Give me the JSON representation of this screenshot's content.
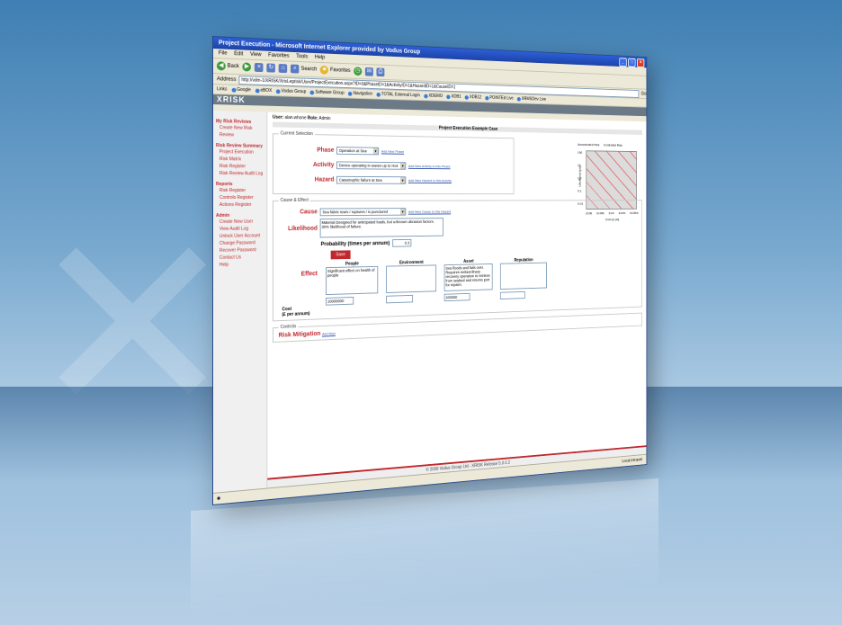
{
  "window": {
    "title": "Project Execution - Microsoft Internet Explorer provided by Vodus Group",
    "menus": [
      "File",
      "Edit",
      "View",
      "Favorites",
      "Tools",
      "Help"
    ],
    "toolbar": {
      "back": "Back",
      "search": "Search",
      "favorites": "Favorites"
    },
    "address_label": "Address",
    "address_value": "http://vdm-1/XRISK/XrisLegrisk/User/ProjectExecution.aspx?ID=3&PhaseID=1&ActivityID=1&HazardID=1&CauseID=1",
    "links_label": "Links",
    "links": [
      "Google",
      "eBOX",
      "Vodus Group",
      "Software Group",
      "Navigation",
      "TOTAL External Login",
      "XDEMO",
      "XDB1",
      "XDB12",
      "POINTEd Live",
      "XRMSDev Live"
    ],
    "go_label": "Go",
    "status_zone": "Local intranet"
  },
  "app": {
    "logo": "XRISK",
    "user_label": "User:",
    "user_name": "alan.whone",
    "role_label": "Role:",
    "role_name": "Admin",
    "page_title": "Project Execution Example Case"
  },
  "sidebar": {
    "sections": [
      {
        "heading": "My Risk Reviews",
        "items": [
          "Create New Risk Review"
        ]
      },
      {
        "heading": "Risk Review Summary",
        "items": [
          "Project Execution",
          "Risk Matrix",
          "Risk Register",
          "Risk Review Audit Log"
        ]
      },
      {
        "heading": "Reports",
        "items": [
          "Risk Register",
          "Controls Register",
          "Actions Register"
        ]
      },
      {
        "heading": "Admin",
        "items": [
          "Create New User",
          "View Audit Log",
          "Unlock User Account",
          "Change Password",
          "Recover Password",
          "Contact Us",
          "Help"
        ]
      }
    ]
  },
  "current_selection": {
    "legend": "Current Selection",
    "phase_label": "Phase",
    "phase_value": "Operation at Sea",
    "phase_link": "Add New Phase",
    "activity_label": "Activity",
    "activity_value": "Device operating in waves up to Hs4",
    "activity_link": "Add New Activity to this Phase",
    "hazard_label": "Hazard",
    "hazard_value": "Catastrophic failure at Sea",
    "hazard_link": "Add New Hazard to this Activity"
  },
  "chart_data": {
    "type": "heatmap",
    "legend": [
      "Uncontrolled Risk",
      "Controlled Risk"
    ],
    "ylabel": "Likelihood (pa)",
    "xlabel": "Cost (£ pa)",
    "y_ticks": [
      "100",
      "10",
      "1.0",
      "0.1",
      "0.01"
    ],
    "x_ticks": [
      "£10k",
      "£100k",
      "£1m",
      "£10m",
      "£100m"
    ]
  },
  "cause_effect": {
    "legend": "Cause & Effect",
    "cause_label": "Cause",
    "cause_value": "Sea fabric tears / ruptures / is punctured",
    "cause_link": "Add New Cause to this Hazard",
    "likelihood_label": "Likelihood",
    "likelihood_text": "Material Designed for anticipated loads, but unknown abrasion factors. 30% likelihood of failure.",
    "probability_label": "Probability (times per annum)",
    "probability_value": "0.3",
    "save_label": "Save",
    "effect_label": "Effect",
    "cost_label": "Cost",
    "cost_unit": "(£ per annum)",
    "columns": [
      {
        "header": "People",
        "text": "Significant effect on health of people",
        "cost": "10000000"
      },
      {
        "header": "Environment",
        "text": "",
        "cost": ""
      },
      {
        "header": "Asset",
        "text": "Sea floods and fails over. Requires extraordinary recovery operation to retrieve from seabed and returns port for repairs.",
        "cost": "200000"
      },
      {
        "header": "Reputation",
        "text": "",
        "cost": ""
      }
    ]
  },
  "controls": {
    "legend": "Controls",
    "risk_mitigation_label": "Risk Mitigation",
    "risk_mitigation_link": "Add New"
  },
  "footer": "© 2009 Vodus Group Ltd - XRISK Release 5.0.0.2"
}
